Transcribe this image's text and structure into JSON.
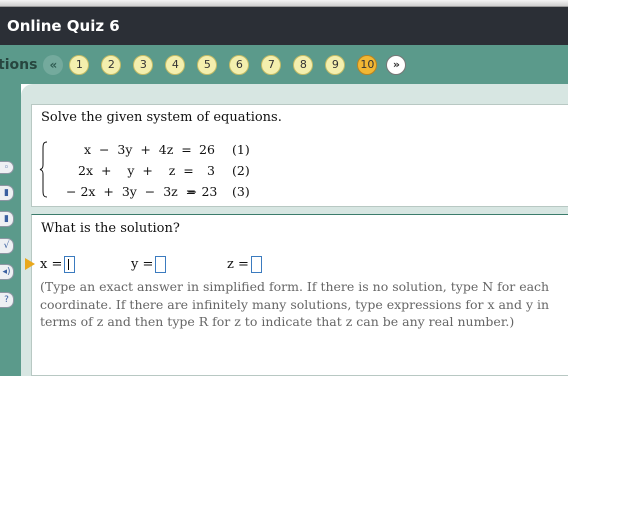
{
  "window": {
    "title": "Online Quiz 6"
  },
  "question_nav": {
    "label": "tions",
    "prev_icon": "«",
    "next_icon": "»",
    "questions": [
      "1",
      "2",
      "3",
      "4",
      "5",
      "6",
      "7",
      "8",
      "9",
      "10"
    ],
    "current": "10"
  },
  "tools": {
    "items": [
      {
        "name": "view-example-icon",
        "glyph": "◦"
      },
      {
        "name": "textbook-icon",
        "glyph": "▮"
      },
      {
        "name": "media-icon",
        "glyph": "▮"
      },
      {
        "name": "calculator-icon",
        "glyph": "√"
      },
      {
        "name": "sound-icon",
        "glyph": "◂)"
      },
      {
        "name": "help-icon",
        "glyph": "?"
      }
    ]
  },
  "problem": {
    "prompt": "Solve the given system of equations.",
    "equations": [
      {
        "lhs": "x  −  3y  +  4z  =",
        "rhs": "26",
        "num": "(1)"
      },
      {
        "lhs": "2x  +    y  +    z  =",
        "rhs": "3",
        "num": "(2)"
      },
      {
        "lhs": "− 2x  +  3y  −  3z  =",
        "rhs": "− 23",
        "num": "(3)"
      }
    ]
  },
  "answer": {
    "question": "What is the solution?",
    "x_label": "x =",
    "y_label": "y =",
    "z_label": "z =",
    "x_value": "",
    "y_value": "",
    "z_value": "",
    "hint": "(Type an exact answer in simplified form.  If there is no solution, type N for each coordinate.  If there are infinitely many solutions, type expressions for x and y in terms of z and then type R for z to indicate that z can be any real number.)"
  },
  "colors": {
    "title_bar": "#2b2f36",
    "nav_bar": "#5b9a8b",
    "question_button": "#f4efae",
    "current_question": "#f2b733",
    "content_background": "#d7e6e2",
    "answer_box_border": "#3b7bbf",
    "hint_text": "#666666"
  }
}
